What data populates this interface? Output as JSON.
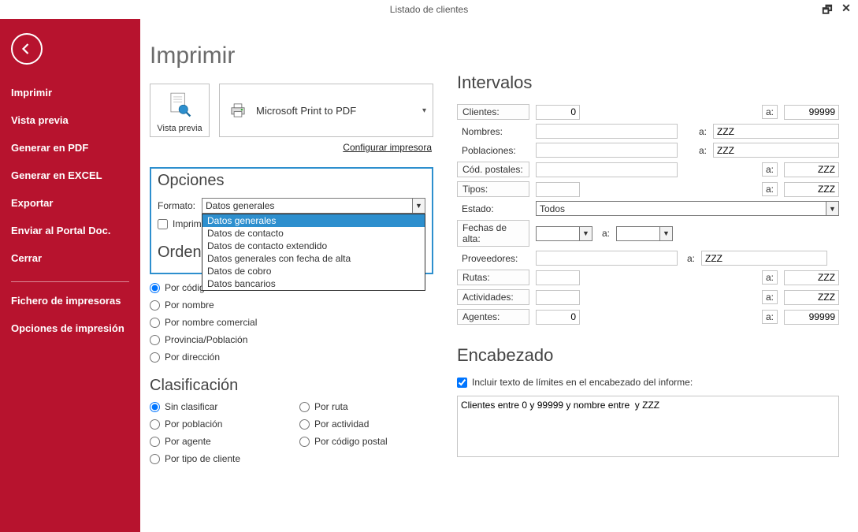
{
  "window": {
    "title": "Listado de clientes"
  },
  "sidebar": {
    "items": [
      "Imprimir",
      "Vista previa",
      "Generar en PDF",
      "Generar en EXCEL",
      "Exportar",
      "Enviar al Portal Doc.",
      "Cerrar"
    ],
    "footer_items": [
      "Fichero de impresoras",
      "Opciones de impresión"
    ]
  },
  "page": {
    "title": "Imprimir",
    "preview_label": "Vista previa",
    "printer_name": "Microsoft Print to PDF",
    "config_link": "Configurar impresora"
  },
  "opciones": {
    "heading": "Opciones",
    "formato_label": "Formato:",
    "formato_value": "Datos generales",
    "formato_options": [
      "Datos generales",
      "Datos de contacto",
      "Datos de contacto extendido",
      "Datos generales con fecha de alta",
      "Datos de cobro",
      "Datos bancarios"
    ],
    "imprimir_checkbox": "Imprimir"
  },
  "orden": {
    "heading": "Orden",
    "options": [
      "Por código",
      "Por nombre",
      "Por nombre comercial",
      "Provincia/Población",
      "Por dirección"
    ],
    "selected": "Por código"
  },
  "clasificacion": {
    "heading": "Clasificación",
    "col1": [
      "Sin clasificar",
      "Por población",
      "Por agente",
      "Por tipo de cliente"
    ],
    "col2": [
      "Por ruta",
      "Por actividad",
      "Por código postal"
    ],
    "selected": "Sin clasificar"
  },
  "intervalos": {
    "heading": "Intervalos",
    "a_label": "a:",
    "rows": [
      {
        "label": "Clientes:",
        "boxed": true,
        "from": "0",
        "to": "99999",
        "narrow": true
      },
      {
        "label": "Nombres:",
        "boxed": false,
        "from": "",
        "to": "ZZZ"
      },
      {
        "label": "Poblaciones:",
        "boxed": false,
        "from": "",
        "to": "ZZZ"
      },
      {
        "label": "Cód. postales:",
        "boxed": true,
        "from": "",
        "to": "ZZZ",
        "to_narrow": true
      },
      {
        "label": "Tipos:",
        "boxed": true,
        "from": "",
        "to": "ZZZ",
        "from_narrow": true,
        "to_narrow": true
      }
    ],
    "estado_label": "Estado:",
    "estado_value": "Todos",
    "fechas_label": "Fechas de alta:",
    "proveedores": {
      "label": "Proveedores:",
      "from": "",
      "to": "ZZZ"
    },
    "tail": [
      {
        "label": "Rutas:",
        "from": "",
        "to": "ZZZ"
      },
      {
        "label": "Actividades:",
        "from": "",
        "to": "ZZZ"
      },
      {
        "label": "Agentes:",
        "from": "0",
        "to": "99999"
      }
    ]
  },
  "encabezado": {
    "heading": "Encabezado",
    "checkbox_label": "Incluir texto de límites en el encabezado del informe:",
    "text": "Clientes entre 0 y 99999 y nombre entre  y ZZZ"
  }
}
